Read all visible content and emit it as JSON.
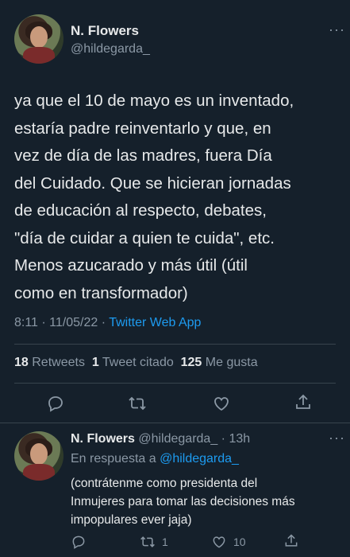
{
  "main_tweet": {
    "author_name": "N. Flowers",
    "handle": "@hildegarda_",
    "text_lines": [
      "ya que el 10 de mayo es un inventado,",
      "estaría padre reinventarlo y que, en",
      "vez de día de las madres, fuera Día",
      "del Cuidado. Que se hicieran jornadas",
      "de educación al respecto, debates,",
      "\"día de cuidar a quien te cuida\", etc.",
      "Menos azucarado y más útil (útil",
      "como en transformador)"
    ],
    "time": "8:11 · 11/05/22 · ",
    "source": "Twitter Web App",
    "stats": {
      "retweets_count": "18",
      "retweets_label": "Retweets",
      "quotes_count": "1",
      "quotes_label": "Tweet citado",
      "likes_count": "125",
      "likes_label": "Me gusta"
    },
    "more": "···"
  },
  "reply": {
    "author_name": "N. Flowers",
    "handle_time": "@hildegarda_ · 13h",
    "reply_prefix": "En respuesta a ",
    "reply_to": "@hildegarda_",
    "text_lines": [
      "(contrátenme como presidenta del",
      "Inmujeres para tomar las decisiones más",
      "impopulares ever jaja)"
    ],
    "retweets": "1",
    "likes": "10",
    "more": "···"
  },
  "colors": {
    "background": "#15202b",
    "text": "#e7e9ea",
    "muted": "#8b98a5",
    "accent": "#1d9bf0"
  }
}
